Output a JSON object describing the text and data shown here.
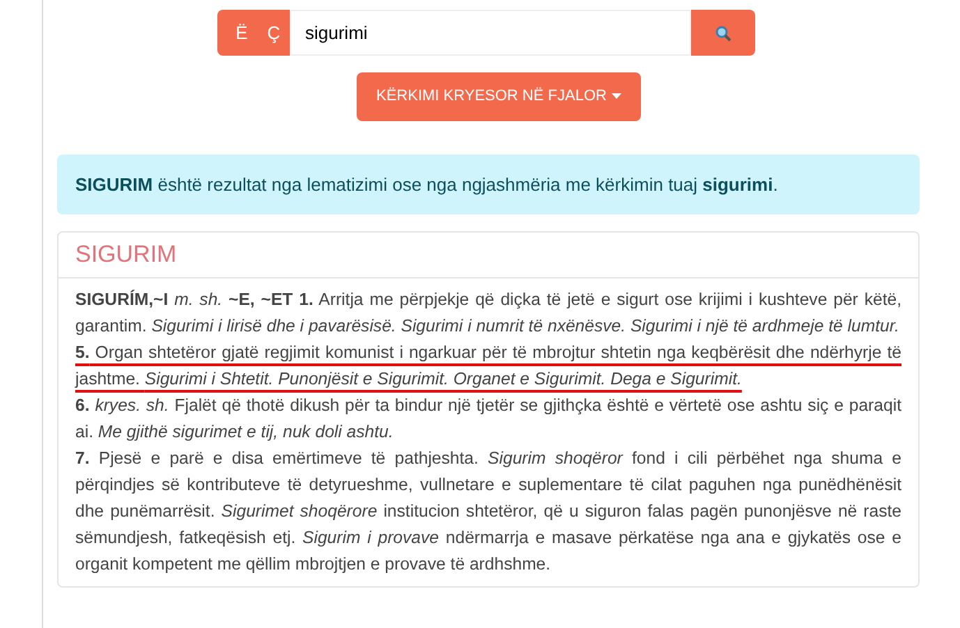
{
  "search": {
    "letter_keys": [
      "Ë",
      "Ç"
    ],
    "value": "sigurimi"
  },
  "mode_button": {
    "label": "KËRKIMI KRYESOR NË FJALOR"
  },
  "notice": "**SIGURIM** është rezultat nga lematizimi ose nga ngjashmëria me kërkimin tuaj **sigurimi**.",
  "entry": {
    "title": "SIGURIM",
    "senses": [
      {
        "text": "**SIGURÍM,~I** *m. sh.* **~E, ~ET 1.** Arritja me përpjekje që diçka të jetë e sigurt ose krijimi i kushteve për këtë, garantim. *Sigurimi i lirisë dhe i pavarësisë. Sigurimi i numrit të nxënësve. Sigurimi i një të ardhmeje të lumtur.*",
        "underlined": false
      },
      {
        "text": "**5.** Organ shtetëror gjatë regjimit komunist i ngarkuar për të mbrojtur shtetin nga keqbërësit dhe ndërhyrje të jashtme. *Sigurimi i Shtetit. Punonjësit e Sigurimit. Organet e Sigurimit. Dega e Sigurimit.*",
        "underlined": true
      },
      {
        "text": "**6.** *kryes. sh.* Fjalët që thotë dikush për ta bindur një tjetër se gjithçka është e vërtetë ose ashtu siç e paraqit ai. *Me gjithë sigurimet e tij, nuk doli ashtu.*",
        "underlined": false
      },
      {
        "text": "**7.** Pjesë e parë e disa emërtimeve të pathjeshta. *Sigurim shoqëror* fond i cili përbëhet nga shuma e përqindjes së kontributeve të detyrueshme, vullnetare e suplementare të cilat paguhen nga punëdhënësit dhe punëmarrësit. *Sigurimet shoqërore* institucion shtetëror, që u siguron falas pagën punonjësve në raste sëmundjesh, fatkeqësish etj. *Sigurim i provave* ndërmarrja e masave përkatëse nga ana e gjykatës ose e organit kompetent me qëllim mbrojtjen e provave të ardhshme.",
        "underlined": false
      }
    ]
  }
}
